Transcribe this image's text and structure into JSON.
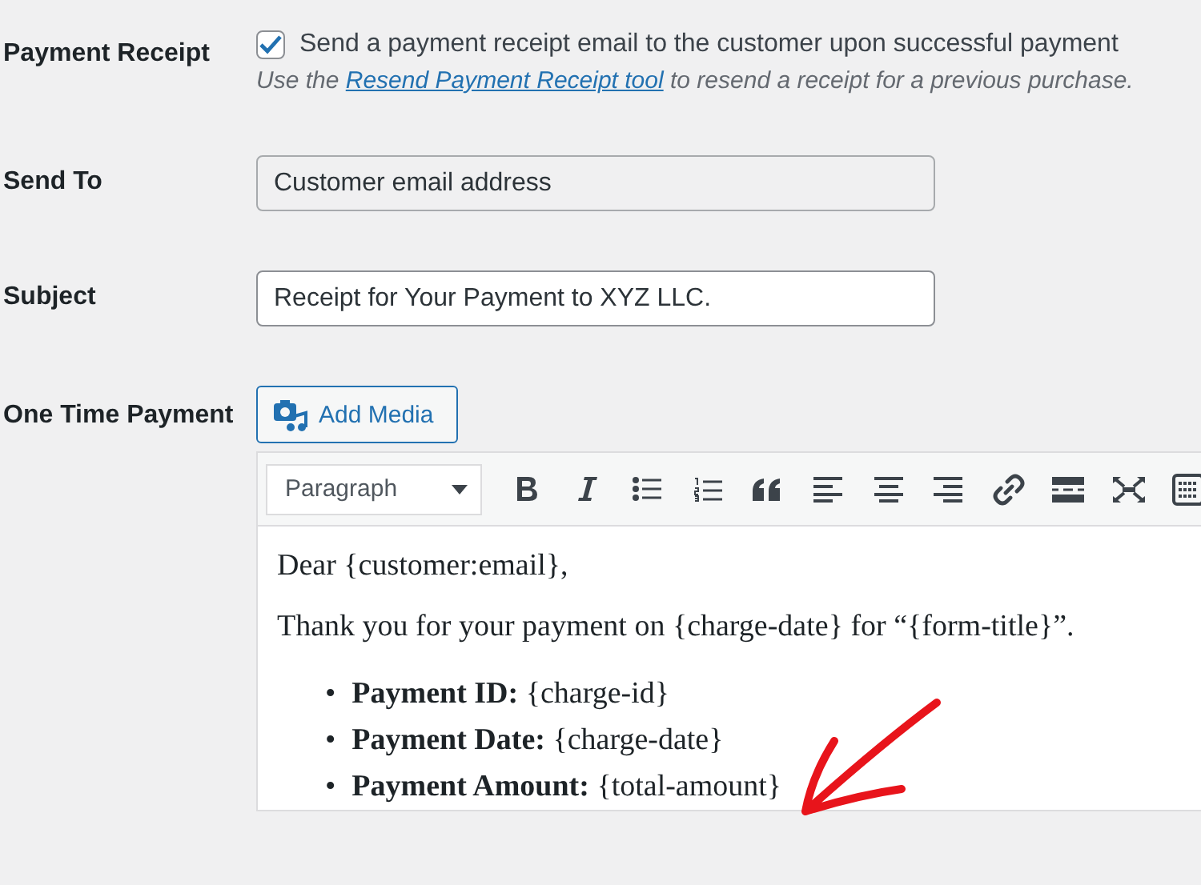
{
  "receipt": {
    "label": "Payment Receipt",
    "checked": true,
    "checkbox_label": "Send a payment receipt email to the customer upon successful payment",
    "help_before": "Use the",
    "help_link": "Resend Payment Receipt tool",
    "help_after": "to resend a receipt for a previous purchase."
  },
  "send_to": {
    "label": "Send To",
    "value": "Customer email address",
    "disabled": true
  },
  "subject": {
    "label": "Subject",
    "value": "Receipt for Your Payment to XYZ LLC."
  },
  "one_time_payment": {
    "label": "One Time Payment",
    "add_media": "Add Media",
    "format_select": "Paragraph",
    "content": {
      "greeting": "Dear {customer:email},",
      "intro": "Thank you for your payment on {charge-date} for “{form-title}”.",
      "items": [
        {
          "marker": "•",
          "text": "**Payment ID:** {charge-id}"
        },
        {
          "marker": "•",
          "text": "**Payment Date:** {charge-date}"
        },
        {
          "marker": "•",
          "text": "**Payment Amount:** {total-amount}"
        }
      ]
    }
  }
}
